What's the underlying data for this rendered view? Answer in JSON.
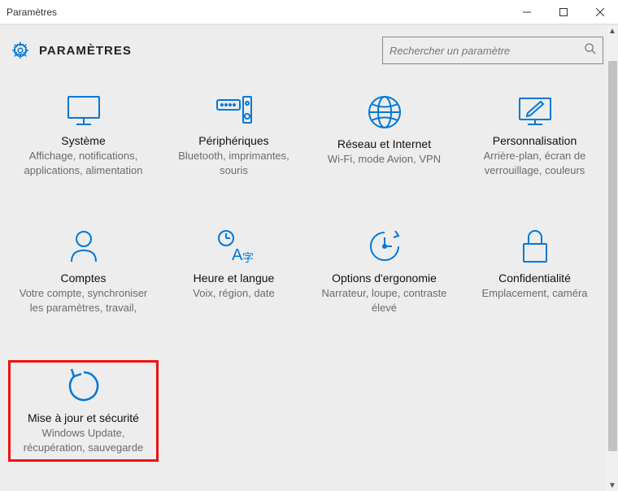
{
  "window": {
    "title": "Paramètres"
  },
  "header": {
    "title": "PARAMÈTRES",
    "search_placeholder": "Rechercher un paramètre"
  },
  "tiles": [
    {
      "title": "Système",
      "sub": "Affichage, notifications, applications, alimentation"
    },
    {
      "title": "Périphériques",
      "sub": "Bluetooth, imprimantes, souris"
    },
    {
      "title": "Réseau et Internet",
      "sub": "Wi-Fi, mode Avion, VPN"
    },
    {
      "title": "Personnalisation",
      "sub": "Arrière-plan, écran de verrouillage, couleurs"
    },
    {
      "title": "Comptes",
      "sub": "Votre compte, synchroniser les paramètres, travail,"
    },
    {
      "title": "Heure et langue",
      "sub": "Voix, région, date"
    },
    {
      "title": "Options d'ergonomie",
      "sub": "Narrateur, loupe, contraste élevé"
    },
    {
      "title": "Confidentialité",
      "sub": "Emplacement, caméra"
    },
    {
      "title": "Mise à jour et sécurité",
      "sub": "Windows Update, récupération, sauvegarde"
    }
  ],
  "colors": {
    "accent": "#0078d7"
  }
}
